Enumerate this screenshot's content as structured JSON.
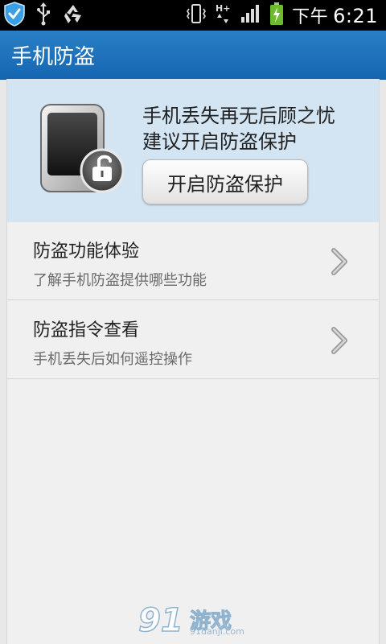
{
  "status_bar": {
    "time": "6:21",
    "ampm": "下午",
    "icons": [
      "shield-check-icon",
      "usb-icon",
      "recycle-icon",
      "vibrate-icon",
      "hplus-data-icon",
      "signal-icon",
      "battery-charging-icon"
    ]
  },
  "title_bar": {
    "title": "手机防盗"
  },
  "hero": {
    "line1": "手机丢失再无后顾之忧",
    "line2": "建议开启防盗保护",
    "button_label": "开启防盗保护",
    "icon": "phone-unlock-icon"
  },
  "list": {
    "items": [
      {
        "title": "防盗功能体验",
        "subtitle": "了解手机防盗提供哪些功能"
      },
      {
        "title": "防盗指令查看",
        "subtitle": "手机丢失后如何遥控操作"
      }
    ]
  },
  "watermark": {
    "brand": "91游戏",
    "site": "91danji.com"
  },
  "colors": {
    "title_bar": "#1d71bb",
    "hero_bg": "#d3e5f3",
    "list_bg": "#f0f0f0"
  }
}
